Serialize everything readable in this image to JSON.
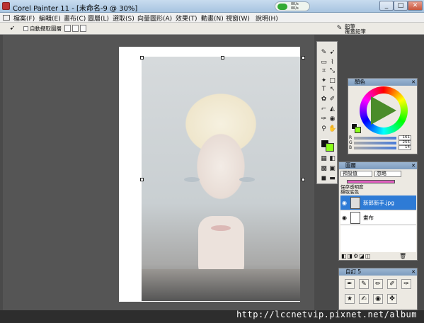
{
  "window": {
    "title": "Corel Painter 11 - [未命名-9 @ 30%]",
    "minimize": "_",
    "maximize": "□",
    "close": "✕"
  },
  "status": {
    "line1": "0K/s",
    "line2": "0K/s"
  },
  "menu": {
    "items": [
      "檔案(F)",
      "編輯(E)",
      "畫布(C)",
      "圖層(L)",
      "選取(S)",
      "向量圖形(A)",
      "效果(T)",
      "動畫(N)",
      "視窗(W)",
      "說明(H)"
    ]
  },
  "propbar": {
    "auto_pickup_label": "自動擷取圖層",
    "brush_category": "鉛筆",
    "brush_variant": "覆蓋鉛筆"
  },
  "color_panel": {
    "title": "顏色",
    "rows": [
      {
        "key": "R",
        "value": "161"
      },
      {
        "key": "G",
        "value": "255"
      },
      {
        "key": "B",
        "value": "14"
      }
    ],
    "main_color": "#111111",
    "additional_color": "#8aff1a"
  },
  "layers_panel": {
    "title": "圖層",
    "composite_method": "預設值",
    "composite_depth": "忽略",
    "option1": "保存透明度",
    "option2": "擷取底色",
    "layers": [
      {
        "name": "新郎新手.jpg",
        "selected": true
      },
      {
        "name": "畫布",
        "selected": false
      }
    ]
  },
  "brush_panel": {
    "title": "自訂 5"
  },
  "watermark": "http://lccnetvip.pixnet.net/album",
  "colors": {
    "title_bar": "#a8c4e0",
    "selection": "#2e7bd6",
    "canvas_bg": "#555555"
  }
}
